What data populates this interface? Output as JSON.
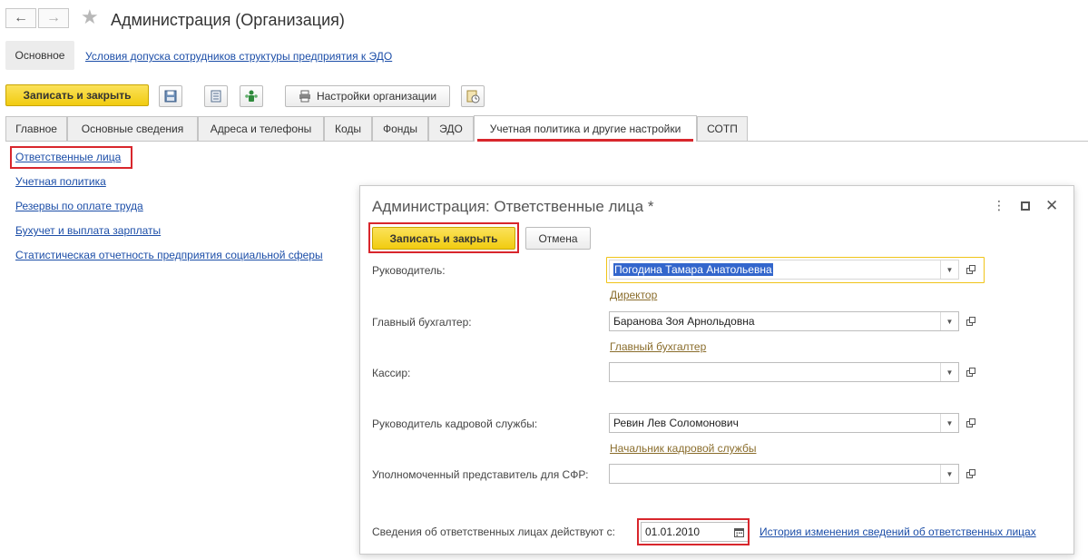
{
  "window": {
    "title": "Администрация (Организация)"
  },
  "nav": {
    "main_label": "Основное",
    "link": "Условия допуска сотрудников структуры предприятия к ЭДО"
  },
  "toolbar": {
    "save_close": "Записать и закрыть",
    "org_settings": "Настройки организации"
  },
  "tabs": [
    {
      "label": "Главное"
    },
    {
      "label": "Основные сведения"
    },
    {
      "label": "Адреса и телефоны"
    },
    {
      "label": "Коды"
    },
    {
      "label": "Фонды"
    },
    {
      "label": "ЭДО"
    },
    {
      "label": "Учетная политика и другие настройки"
    },
    {
      "label": "СОТП"
    }
  ],
  "left_links": [
    "Ответственные лица",
    "Учетная политика",
    "Резервы по оплате труда",
    "Бухучет и выплата зарплаты",
    "Статистическая отчетность предприятия социальной сферы"
  ],
  "dialog": {
    "title": "Администрация: Ответственные лица *",
    "save_close": "Записать и закрыть",
    "cancel": "Отмена",
    "fields": [
      {
        "label": "Руководитель:",
        "value": "Погодина Тамара Анатольевна",
        "position": "Директор"
      },
      {
        "label": "Главный бухгалтер:",
        "value": "Баранова Зоя Арнольдовна",
        "position": "Главный бухгалтер"
      },
      {
        "label": "Кассир:",
        "value": "",
        "position": ""
      },
      {
        "label": "Руководитель кадровой службы:",
        "value": "Ревин Лев Соломонович",
        "position": "Начальник кадровой службы"
      },
      {
        "label": "Уполномоченный представитель для СФР:",
        "value": "",
        "position": ""
      }
    ],
    "effective_label": "Сведения об ответственных лицах действуют с:",
    "effective_date": "01.01.2010",
    "history_link": "История изменения сведений об ответственных лицах"
  },
  "colors": {
    "accent_yellow": "#f6d21c",
    "highlight_red": "#d8262c",
    "link_blue": "#1c4ea8",
    "position_link": "#8a6d2c",
    "selection": "#3366cc"
  }
}
